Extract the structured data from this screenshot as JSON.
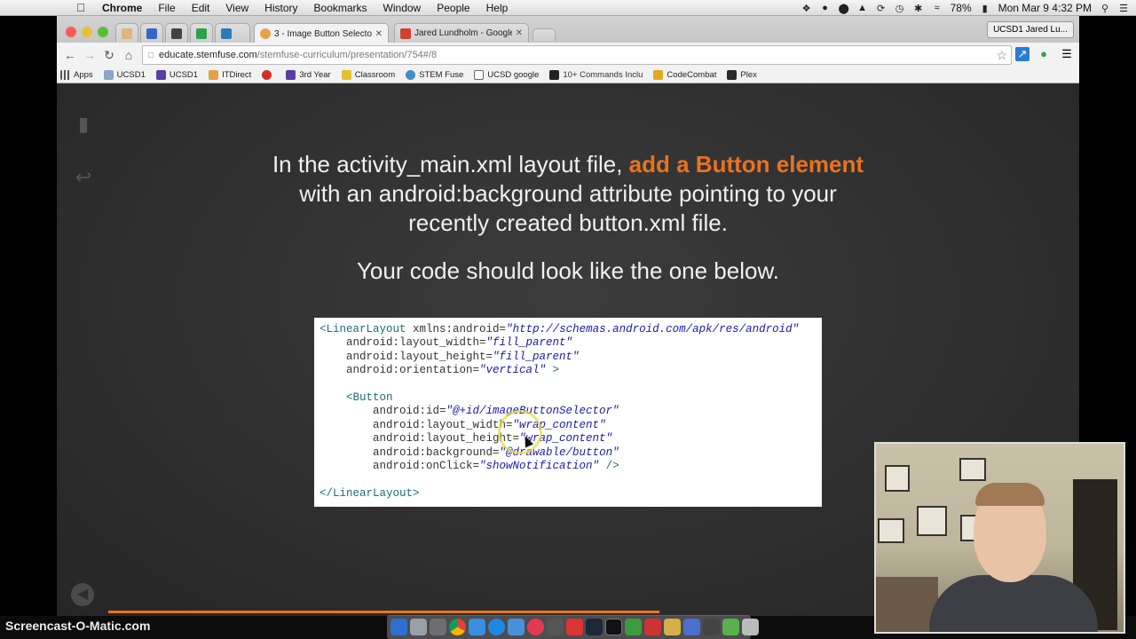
{
  "menubar": {
    "app": "Chrome",
    "items": [
      "File",
      "Edit",
      "View",
      "History",
      "Bookmarks",
      "Window",
      "People",
      "Help"
    ],
    "battery": "78%",
    "clock": "Mon Mar 9  4:32 PM"
  },
  "browser": {
    "tabs": [
      {
        "label": "3 - Image Button Selector",
        "active": true
      },
      {
        "label": "Jared Lundholm - Google+",
        "active": false
      }
    ],
    "profile": "UCSD1 Jared Lu...",
    "url_host": "educate.stemfuse.com",
    "url_path": "/stemfuse-curriculum/presentation/754#/8",
    "bookmarks": [
      "Apps",
      "UCSD1",
      "UCSD1",
      "ITDirect",
      "3rd Year",
      "Classroom",
      "STEM Fuse",
      "UCSD google",
      "10+ Commands Inclu",
      "CodeCombat",
      "Plex"
    ]
  },
  "slide": {
    "line1_a": "In the activity_main.xml layout file, ",
    "line1_b": "add a Button element",
    "line2": "with an android:background attribute pointing to your",
    "line3": "recently created button.xml file.",
    "sub": "Your code should look like the one below.",
    "code": {
      "l1_tag": "<LinearLayout",
      "l1_attr": " xmlns:android=",
      "l1_val": "\"http://schemas.android.com/apk/res/android\"",
      "l2_attr": "    android:layout_width=",
      "l2_val": "\"fill_parent\"",
      "l3_attr": "    android:layout_height=",
      "l3_val": "\"fill_parent\"",
      "l4_attr": "    android:orientation=",
      "l4_val": "\"vertical\"",
      "l4_end": " >",
      "l6_tag": "    <Button",
      "l7_attr": "        android:id=",
      "l7_val": "\"@+id/imageButtonSelector\"",
      "l8_attr": "        android:layout_width=",
      "l8_val": "\"wrap_content\"",
      "l9_attr": "        android:layout_height=",
      "l9_val": "\"wrap_content\"",
      "l10_attr": "        android:background=",
      "l10_val": "\"@drawable/button\"",
      "l11_attr": "        android:onClick=",
      "l11_val": "\"showNotification\"",
      "l11_end": " />",
      "l13_tag": "</LinearLayout>"
    },
    "progress": 0.568
  },
  "watermark": "Screencast-O-Matic.com",
  "colors": {
    "accent": "#e8731e"
  }
}
